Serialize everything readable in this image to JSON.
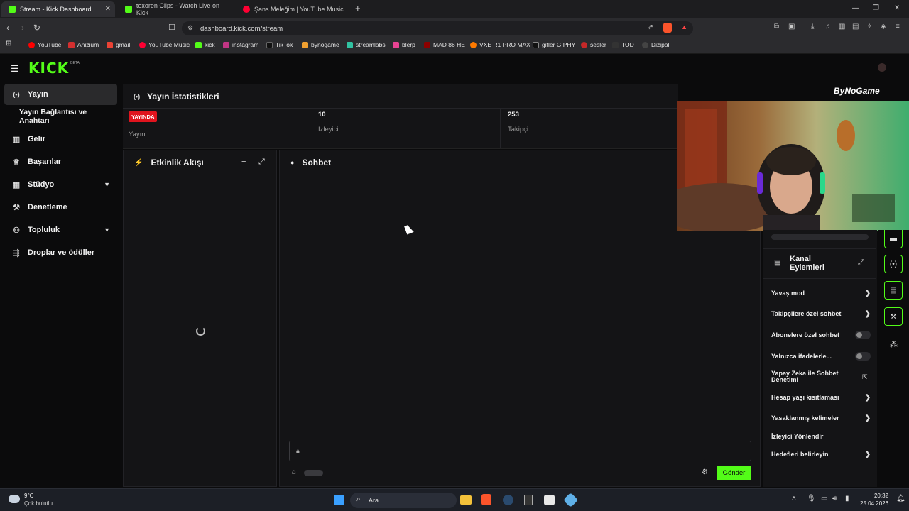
{
  "browser": {
    "tabs": [
      {
        "title": "Stream - Kick Dashboard",
        "active": true
      },
      {
        "title": "texoren Clips - Watch Live on Kick",
        "active": false
      },
      {
        "title": "Şans Meleğim | YouTube Music",
        "active": false
      }
    ],
    "url": "dashboard.kick.com/stream",
    "bookmarks": [
      "YouTube",
      "Anizium",
      "gmail",
      "YouTube Music",
      "kick",
      "instagram",
      "TikTok",
      "bynogame",
      "streamlabs",
      "blerp",
      "MAD 86 HE",
      "VXE R1 PRO MAX",
      "gifler GIPHY",
      "sesler",
      "TOD",
      "Dizipal"
    ]
  },
  "kick": {
    "logo": "KICK",
    "logo_sup": "BETA",
    "sidebar": [
      {
        "label": "Yayın",
        "icon": "broadcast-icon",
        "active": true
      },
      {
        "label": "Yayın Bağlantısı ve Anahtarı",
        "icon": "",
        "active": false
      },
      {
        "label": "Gelir",
        "icon": "chart-icon",
        "active": false
      },
      {
        "label": "Başarılar",
        "icon": "trophy-icon",
        "active": false
      },
      {
        "label": "Stüdyo",
        "icon": "studio-icon",
        "active": false,
        "expandable": true
      },
      {
        "label": "Denetleme",
        "icon": "wrench-icon",
        "active": false
      },
      {
        "label": "Topluluk",
        "icon": "community-icon",
        "active": false,
        "expandable": true
      },
      {
        "label": "Droplar ve ödüller",
        "icon": "drops-icon",
        "active": false
      }
    ],
    "stats": {
      "title": "Yayın İstatistikleri",
      "items": [
        {
          "value": "YAYINDA",
          "label": "Yayın"
        },
        {
          "value": "10",
          "label": "İzleyici"
        },
        {
          "value": "253",
          "label": "Takipçi"
        }
      ]
    },
    "feed_title": "Etkinlik Akışı",
    "chat_title": "Sohbet",
    "send_label": "Gönder",
    "watermark": "ByNoGame",
    "channel_actions": {
      "title": "Kanal Eylemleri",
      "items": [
        {
          "label": "Yavaş mod",
          "kind": "arrow"
        },
        {
          "label": "Takipçilere özel sohbet",
          "kind": "arrow"
        },
        {
          "label": "Abonelere özel sohbet",
          "kind": "toggle"
        },
        {
          "label": "Yalnızca ifadelerle...",
          "kind": "toggle"
        },
        {
          "label": "Yapay Zeka ile Sohbet Denetimi",
          "kind": "external"
        },
        {
          "label": "Hesap yaşı kısıtlaması",
          "kind": "arrow"
        },
        {
          "label": "Yasaklanmış kelimeler",
          "kind": "arrow"
        },
        {
          "label": "İzleyici Yönlendir",
          "kind": "none"
        },
        {
          "label": "Hedefleri belirleyin",
          "kind": "arrow"
        }
      ]
    }
  },
  "taskbar": {
    "weather_temp": "9°C",
    "weather_desc": "Çok bulutlu",
    "search": "Ara",
    "time": "20:32",
    "date": "25.04.2026"
  },
  "colors": {
    "accent": "#53fc18",
    "live": "#e0141e"
  }
}
